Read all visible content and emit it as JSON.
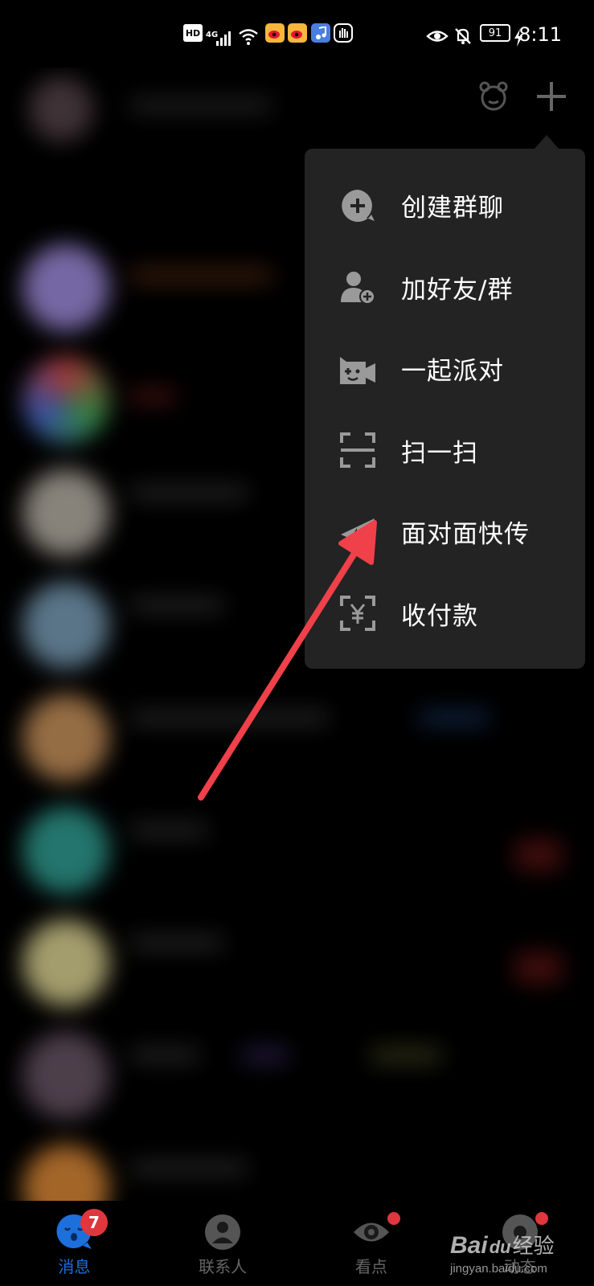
{
  "status_bar": {
    "hd": "HD",
    "network": "4G",
    "battery": "91",
    "time": "8:11"
  },
  "menu": {
    "items": [
      {
        "label": "创建群聊",
        "icon": "chat-plus-icon"
      },
      {
        "label": "加好友/群",
        "icon": "add-friend-icon"
      },
      {
        "label": "一起派对",
        "icon": "party-game-icon"
      },
      {
        "label": "扫一扫",
        "icon": "scan-icon"
      },
      {
        "label": "面对面快传",
        "icon": "quick-send-icon"
      },
      {
        "label": "收付款",
        "icon": "payment-icon"
      }
    ]
  },
  "bottom_nav": {
    "tabs": [
      {
        "label": "消息",
        "icon": "messages-icon",
        "active": true,
        "badge": "7"
      },
      {
        "label": "联系人",
        "icon": "contacts-icon",
        "active": false
      },
      {
        "label": "看点",
        "icon": "eye-icon",
        "active": false
      },
      {
        "label": "动态",
        "icon": "moments-icon",
        "active": false
      }
    ]
  },
  "watermark": {
    "brand": "Bai",
    "paw": "du",
    "suffix": "经验",
    "url": "jingyan.baidu.com"
  },
  "colors": {
    "accent": "#1d6fdc",
    "badge": "#e0363d",
    "menu_bg": "#232323",
    "arrow": "#f0404a"
  }
}
